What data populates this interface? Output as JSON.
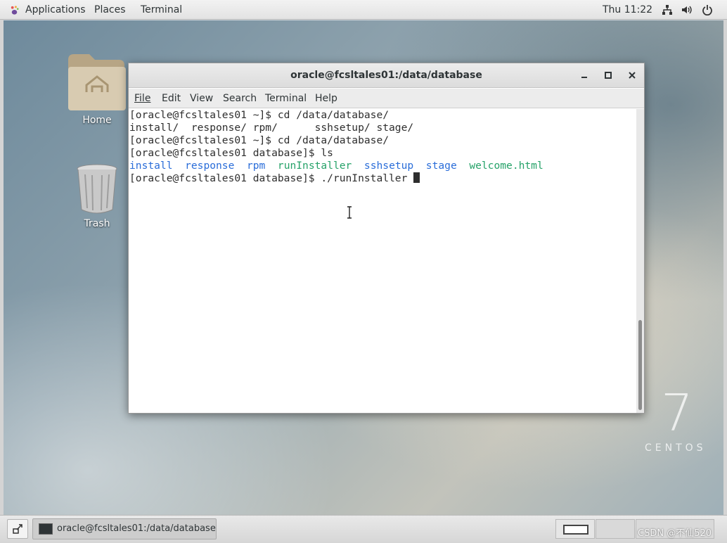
{
  "topbar": {
    "applications": "Applications",
    "places": "Places",
    "terminal": "Terminal",
    "clock": "Thu 11:22",
    "icons": [
      "network-icon",
      "volume-icon",
      "power-icon"
    ]
  },
  "desktop": {
    "home_label": "Home",
    "trash_label": "Trash",
    "brand_number": "7",
    "brand_text": "CENTOS"
  },
  "window": {
    "title": "oracle@fcsltales01:/data/database",
    "menu": [
      "File",
      "Edit",
      "View",
      "Search",
      "Terminal",
      "Help"
    ],
    "lines": {
      "l1": "[oracle@fcsltales01 ~]$ cd /data/database/",
      "l2": "install/  response/ rpm/      sshsetup/ stage/",
      "l3": "[oracle@fcsltales01 ~]$ cd /data/database/",
      "l4": "[oracle@fcsltales01 database]$ ls",
      "l6": "[oracle@fcsltales01 database]$ ./runInstaller "
    },
    "ls_output": {
      "install": "install",
      "response": "response",
      "rpm": "rpm",
      "runInstaller": "runInstaller",
      "sshsetup": "sshsetup",
      "stage": "stage",
      "welcome": "welcome.html"
    },
    "colors": {
      "dir": "#2a6dd9",
      "exec": "#26a269"
    }
  },
  "taskbar": {
    "task_label": "oracle@fcsltales01:/data/database",
    "watermark": "CSDN @不仙520"
  }
}
